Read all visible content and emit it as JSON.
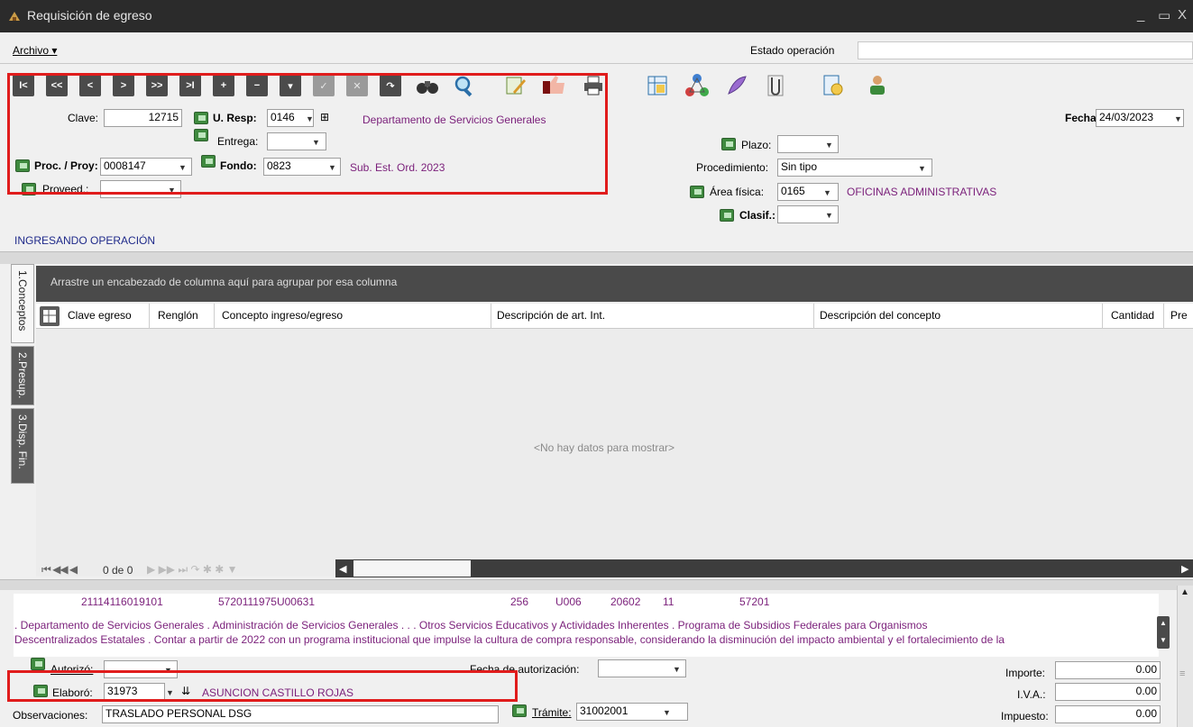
{
  "window": {
    "title": "Requisición de egreso",
    "controls": [
      "_",
      "▭",
      "X"
    ]
  },
  "menu": {
    "archivo": "Archivo ▾",
    "estado_label": "Estado operación",
    "estado_value": ""
  },
  "toolbar": {
    "nav": [
      "I<",
      "<<",
      "<",
      ">",
      ">>",
      ">I",
      "+",
      "−",
      "▾",
      "✓",
      "✕",
      "↷"
    ],
    "tools": [
      "binoculars-icon",
      "search-icon",
      "edit-icon",
      "thumbs-icon",
      "print-icon",
      "grid-icon",
      "network-icon",
      "feather-icon",
      "attach-icon",
      "report-icon",
      "user-icon"
    ]
  },
  "form": {
    "clave_label": "Clave:",
    "clave_value": "12715",
    "uresp_label": "U. Resp:",
    "uresp_value": "0146",
    "uresp_desc": "Departamento de Servicios Generales",
    "entrega_label": "Entrega:",
    "entrega_value": "",
    "proc_label": "Proc. / Proy:",
    "proc_value": "0008147",
    "fondo_label": "Fondo:",
    "fondo_value": "0823",
    "fondo_desc": "Sub. Est. Ord. 2023",
    "proveed_label": "Proveed.:",
    "proveed_value": "",
    "fecha_label": "Fecha:",
    "fecha_value": "24/03/2023",
    "plazo_label": "Plazo:",
    "plazo_value": "",
    "procedimiento_label": "Procedimiento:",
    "procedimiento_value": "Sin tipo",
    "area_label": "Área física:",
    "area_value": "0165",
    "area_desc": "OFICINAS ADMINISTRATIVAS",
    "clasif_label": "Clasif.:",
    "clasif_value": "",
    "status": "INGRESANDO OPERACIÓN"
  },
  "tabs": [
    "1.Conceptos",
    "2.Presup.",
    "3.Disp. Fin."
  ],
  "grid": {
    "group_hint": "Arrastre un encabezado de columna aquí para agrupar por esa columna",
    "columns": [
      "Clave egreso",
      "Renglón",
      "Concepto ingreso/egreso",
      "Descripción de art. Int.",
      "Descripción del concepto",
      "Cantidad",
      "Pre"
    ],
    "empty": "<No hay datos para mostrar>",
    "pager": "0 de 0"
  },
  "lower": {
    "codes": [
      "21114116019101",
      "5720111975U00631",
      "256",
      "U006",
      "20602",
      "11",
      "57201"
    ],
    "desc_line1": ". Departamento de Servicios Generales . Administración de Servicios Generales . . . Otros Servicios Educativos y Actividades Inherentes . Programa de Subsidios Federales para Organismos",
    "desc_line2": "Descentralizados Estatales . Contar a partir de 2022 con un programa institucional que impulse la cultura de compra responsable, considerando la disminución del impacto ambiental y el fortalecimiento de la",
    "autorizo_label": "Autorizó:",
    "autorizo_value": "",
    "fecha_aut_label": "Fecha de autorización:",
    "fecha_aut_value": "",
    "elaboro_label": "Elaboró:",
    "elaboro_value": "31973",
    "elaboro_desc": "ASUNCION CASTILLO ROJAS",
    "obs_label": "Observaciones:",
    "obs_value": "TRASLADO PERSONAL DSG",
    "tramite_label": "Trámite:",
    "tramite_value": "31002001",
    "importe_label": "Importe:",
    "importe_value": "0.00",
    "iva_label": "I.V.A.:",
    "iva_value": "0.00",
    "impuesto_label": "Impuesto:",
    "impuesto_value": "0.00"
  }
}
